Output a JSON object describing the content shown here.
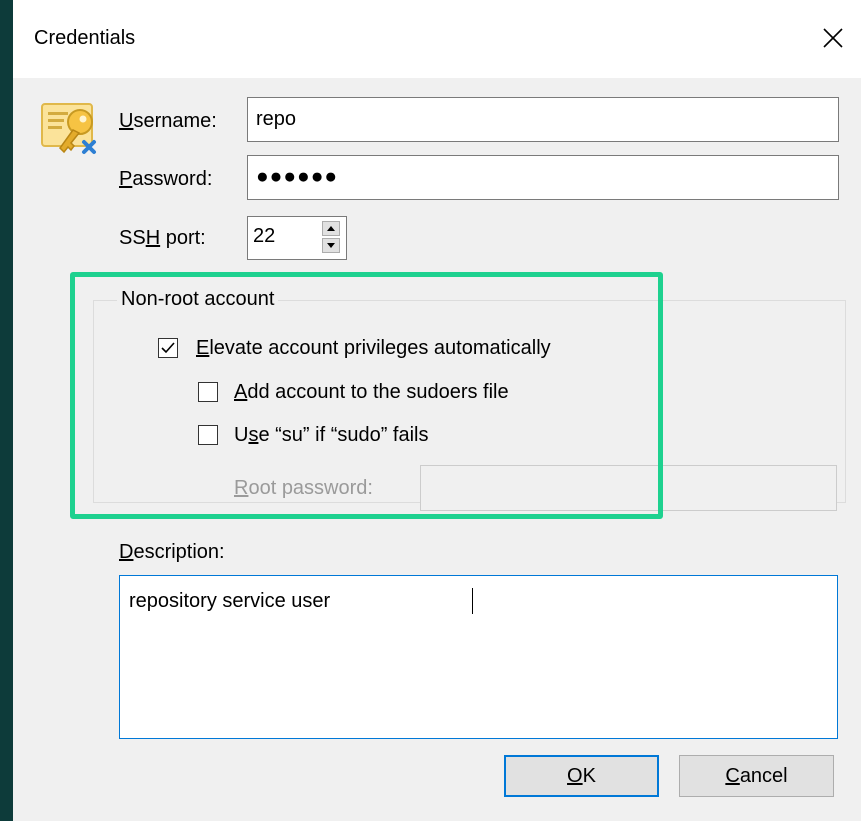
{
  "dialog": {
    "title": "Credentials"
  },
  "fields": {
    "username": {
      "label_key": "U",
      "label_rest": "sername:",
      "value": "repo"
    },
    "password": {
      "label_key": "P",
      "label_rest": "assword:",
      "masked_value": "●●●●●●"
    },
    "ssh_port": {
      "label_pre": "SS",
      "label_key": "H",
      "label_rest": " port:",
      "value": "22"
    }
  },
  "non_root": {
    "group_title": "Non-root account",
    "elevate": {
      "label_key": "E",
      "label_rest": "levate account privileges automatically",
      "checked": true
    },
    "sudoers": {
      "label_key": "A",
      "label_rest": "dd account to the sudoers file",
      "checked": false
    },
    "use_su": {
      "label_pre": "U",
      "label_key": "s",
      "label_rest": "e “su” if “sudo” fails",
      "checked": false
    },
    "root_password": {
      "label_key": "R",
      "label_rest": "oot password:",
      "value": ""
    }
  },
  "description": {
    "label_key": "D",
    "label_rest": "escription:",
    "value": "repository service user"
  },
  "buttons": {
    "ok": {
      "label_key": "O",
      "label_rest": "K"
    },
    "cancel": {
      "label_key": "C",
      "label_rest": "ancel"
    }
  },
  "colors": {
    "highlight": "#1ed18f",
    "focus_accent": "#0078d7",
    "icon_yellow": "#f6c343",
    "icon_blue": "#2d7fd3"
  },
  "icons": [
    "close-icon",
    "credentials-key-icon",
    "spin-up-icon",
    "spin-down-icon",
    "checkmark-icon"
  ]
}
